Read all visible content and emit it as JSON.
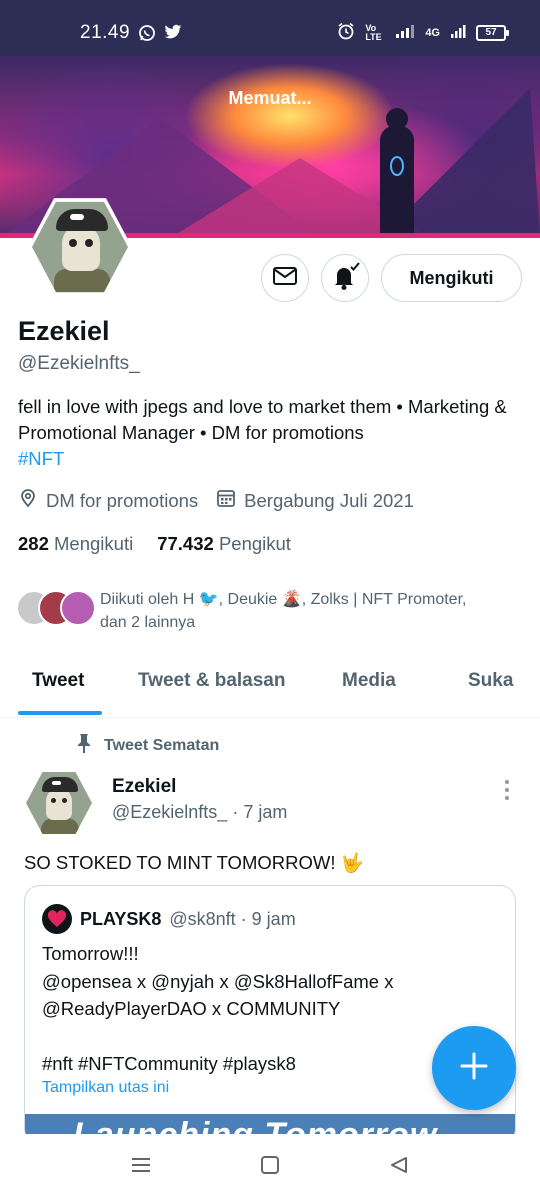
{
  "status_bar": {
    "time": "21.49",
    "network": "4G",
    "volte": "Vo LTE",
    "battery": "57"
  },
  "banner": {
    "loading_text": "Memuat..."
  },
  "profile": {
    "following_button": "Mengikuti",
    "name": "Ezekiel",
    "handle": "@Ezekielnfts_",
    "bio_text": "fell in love with jpegs and love to market them • Marketing & Promotional Manager • DM for promotions",
    "bio_hashtag": "#NFT",
    "location": "DM for promotions",
    "joined": "Bergabung Juli 2021",
    "following_count": "282",
    "following_label": "Mengikuti",
    "followers_count": "77.432",
    "followers_label": "Pengikut",
    "followed_by_line1": "Diikuti oleh H 🐦, Deukie 🌋, Zolks | NFT Promoter,",
    "followed_by_line2": "dan 2 lainnya"
  },
  "tabs": [
    {
      "label": "Tweet",
      "active": true
    },
    {
      "label": "Tweet & balasan",
      "active": false
    },
    {
      "label": "Media",
      "active": false
    },
    {
      "label": "Suka",
      "active": false
    }
  ],
  "pinned_tweet": {
    "pinned_label": "Tweet Sematan",
    "author_name": "Ezekiel",
    "author_meta": "@Ezekielnfts_ · 7 jam",
    "text": "SO STOKED TO MINT TOMORROW! 🤟",
    "quote": {
      "name": "PLAYSK8",
      "meta": "@sk8nft · 9 jam",
      "line1": "Tomorrow!!!",
      "line2": "@opensea x @nyjah x @Sk8HallofFame x",
      "line3": "@ReadyPlayerDAO x COMMUNITY",
      "line4": "",
      "line5": "#nft #NFTCommunity #playsk8",
      "show_thread": "Tampilkan utas ini",
      "image_text": "Launching Tomorrow"
    }
  },
  "colors": {
    "accent": "#1d9bf0",
    "status_bar_bg": "#2d2e55",
    "text_primary": "#0f1419",
    "text_secondary": "#536471"
  }
}
